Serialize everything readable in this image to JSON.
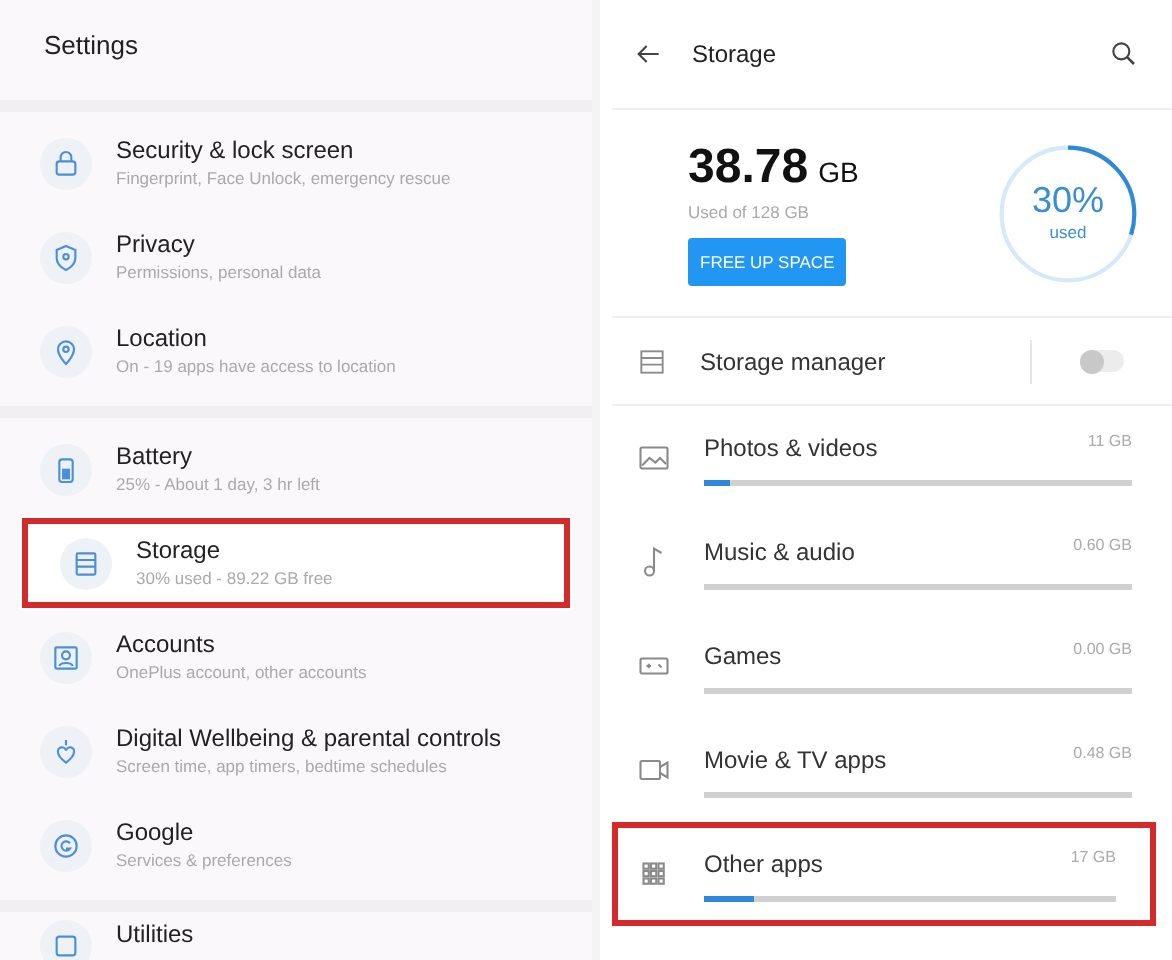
{
  "settings": {
    "title": "Settings",
    "groups": [
      {
        "items": [
          {
            "title": "Security & lock screen",
            "subtitle": "Fingerprint, Face Unlock, emergency rescue",
            "highlighted": false
          },
          {
            "title": "Privacy",
            "subtitle": "Permissions, personal data",
            "highlighted": false
          },
          {
            "title": "Location",
            "subtitle": "On - 19 apps have access to location",
            "highlighted": false
          }
        ]
      },
      {
        "items": [
          {
            "title": "Battery",
            "subtitle": "25% - About 1 day, 3 hr left",
            "highlighted": false
          },
          {
            "title": "Storage",
            "subtitle": "30% used - 89.22 GB free",
            "highlighted": true
          },
          {
            "title": "Accounts",
            "subtitle": "OnePlus account, other accounts",
            "highlighted": false
          },
          {
            "title": "Digital Wellbeing & parental controls",
            "subtitle": "Screen time, app timers, bedtime schedules",
            "highlighted": false
          },
          {
            "title": "Google",
            "subtitle": "Services & preferences",
            "highlighted": false
          }
        ]
      },
      {
        "items": [
          {
            "title": "Utilities",
            "highlighted": false
          }
        ]
      }
    ]
  },
  "storage": {
    "title": "Storage",
    "used_value": "38.78",
    "used_unit": "GB",
    "used_of": "Used of 128 GB",
    "free_button": "FREE UP SPACE",
    "ring": {
      "percent": "30%",
      "caption": "used",
      "level": 0.3
    },
    "manager": {
      "label": "Storage manager",
      "on": false
    },
    "categories": [
      {
        "label": "Photos & videos",
        "size": "11 GB",
        "level": 0.06,
        "highlighted": false
      },
      {
        "label": "Music & audio",
        "size": "0.60 GB",
        "highlighted": false
      },
      {
        "label": "Games",
        "size": "0.00 GB",
        "highlighted": false
      },
      {
        "label": "Movie & TV apps",
        "size": "0.48 GB",
        "highlighted": false
      },
      {
        "label": "Other apps",
        "size": "17 GB",
        "level": 0.12,
        "highlighted": true
      }
    ]
  }
}
